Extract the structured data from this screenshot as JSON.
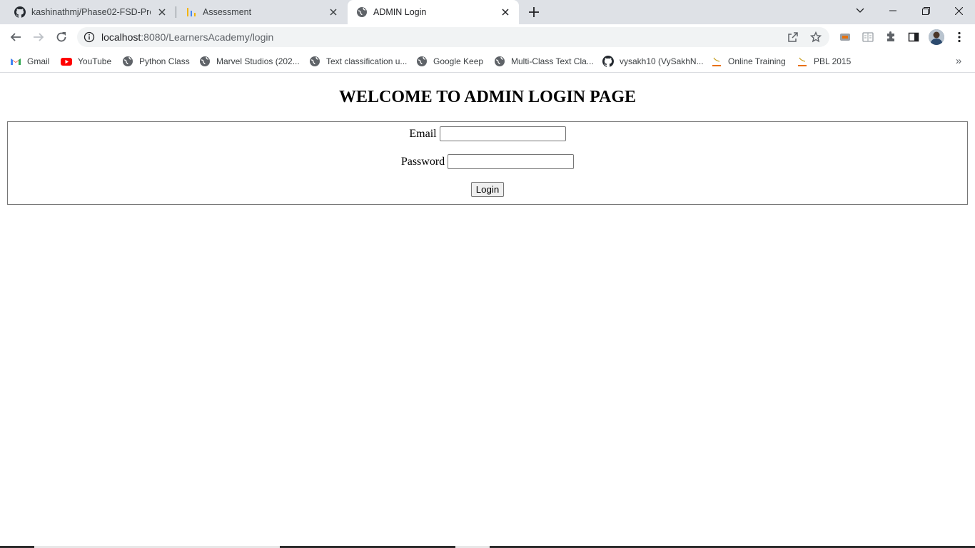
{
  "browser": {
    "tabs": [
      {
        "title": "kashinathmj/Phase02-FSD-Projec",
        "icon": "github-icon",
        "active": false
      },
      {
        "title": "Assessment",
        "icon": "bar-chart-icon",
        "active": false
      },
      {
        "title": "ADMIN Login",
        "icon": "globe-icon",
        "active": true
      }
    ],
    "address": {
      "host": "localhost",
      "rest": ":8080/LearnersAcademy/login"
    },
    "bookmarks": [
      {
        "label": "Gmail",
        "icon": "gmail-icon"
      },
      {
        "label": "YouTube",
        "icon": "youtube-icon"
      },
      {
        "label": "Python Class",
        "icon": "globe-icon"
      },
      {
        "label": "Marvel Studios (202...",
        "icon": "globe-icon"
      },
      {
        "label": "Text classification u...",
        "icon": "globe-icon"
      },
      {
        "label": "Google Keep",
        "icon": "globe-icon"
      },
      {
        "label": "Multi-Class Text Cla...",
        "icon": "globe-icon"
      },
      {
        "label": "vysakh10 (VySakhN...",
        "icon": "github-icon"
      },
      {
        "label": "Online Training",
        "icon": "pbl-icon"
      },
      {
        "label": "PBL 2015",
        "icon": "pbl-icon"
      }
    ],
    "bookmarks_more": "»"
  },
  "page": {
    "heading": "WELCOME TO ADMIN LOGIN PAGE",
    "form": {
      "email_label": "Email",
      "email_value": "",
      "password_label": "Password",
      "password_value": "",
      "submit_label": "Login"
    }
  },
  "colors": {
    "tabstrip_bg": "#dee1e6",
    "omnibox_bg": "#f1f3f4",
    "button_bg": "#efefef"
  }
}
